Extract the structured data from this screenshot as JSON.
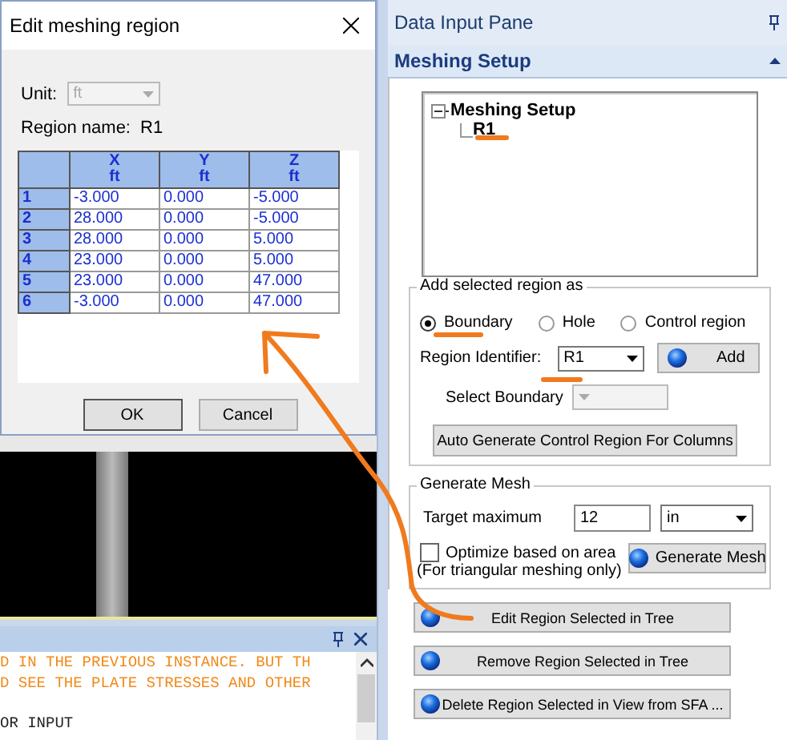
{
  "dialog": {
    "title": "Edit meshing region",
    "unit_label": "Unit:",
    "unit_value": "ft",
    "region_name_label": "Region name:",
    "region_name": "R1",
    "columns": [
      {
        "name": "X",
        "unit": "ft"
      },
      {
        "name": "Y",
        "unit": "ft"
      },
      {
        "name": "Z",
        "unit": "ft"
      }
    ],
    "rows": [
      {
        "index": "1",
        "cells": [
          "-3.000",
          "0.000",
          "-5.000"
        ]
      },
      {
        "index": "2",
        "cells": [
          "28.000",
          "0.000",
          "-5.000"
        ]
      },
      {
        "index": "3",
        "cells": [
          "28.000",
          "0.000",
          "5.000"
        ]
      },
      {
        "index": "4",
        "cells": [
          "23.000",
          "0.000",
          "5.000"
        ]
      },
      {
        "index": "5",
        "cells": [
          "23.000",
          "0.000",
          "47.000"
        ]
      },
      {
        "index": "6",
        "cells": [
          "-3.000",
          "0.000",
          "47.000"
        ]
      }
    ],
    "buttons": [
      "OK",
      "Cancel"
    ]
  },
  "output_pane": {
    "lines": [
      {
        "text": "D IN THE PREVIOUS INSTANCE. BUT TH",
        "kind": "message"
      },
      {
        "text": "D SEE THE PLATE STRESSES AND OTHER",
        "kind": "message"
      },
      {
        "kind": "blank"
      },
      {
        "text": "OR INPUT",
        "kind": "plain"
      }
    ]
  },
  "data_input_pane": {
    "title": "Data Input Pane",
    "section": {
      "title": "Meshing Setup",
      "expanded": true
    },
    "tree": [
      {
        "label": "Meshing Setup",
        "expanded": true,
        "children": [
          {
            "label": "R1"
          }
        ]
      }
    ],
    "add_region": {
      "title": "Add selected region as",
      "options": [
        {
          "label": "Boundary",
          "selected": true
        },
        {
          "label": "Hole",
          "selected": false
        },
        {
          "label": "Control region",
          "selected": false
        }
      ],
      "region_identifier_label": "Region Identifier:",
      "region_identifier": "R1",
      "add_button": "Add",
      "select_boundary_label": "Select Boundary",
      "auto_button": "Auto Generate Control Region For Columns"
    },
    "generate_mesh": {
      "title": "Generate Mesh",
      "target_label": "Target maximum",
      "target_value": "12",
      "target_unit": "in",
      "optimize_label": "Optimize based on area",
      "optimize_checked": false,
      "note": "(For triangular meshing only)",
      "button": "Generate Mesh"
    },
    "actions": [
      "Edit Region Selected in Tree",
      "Remove Region Selected in Tree",
      "Delete Region Selected in View from SFA ..."
    ]
  }
}
